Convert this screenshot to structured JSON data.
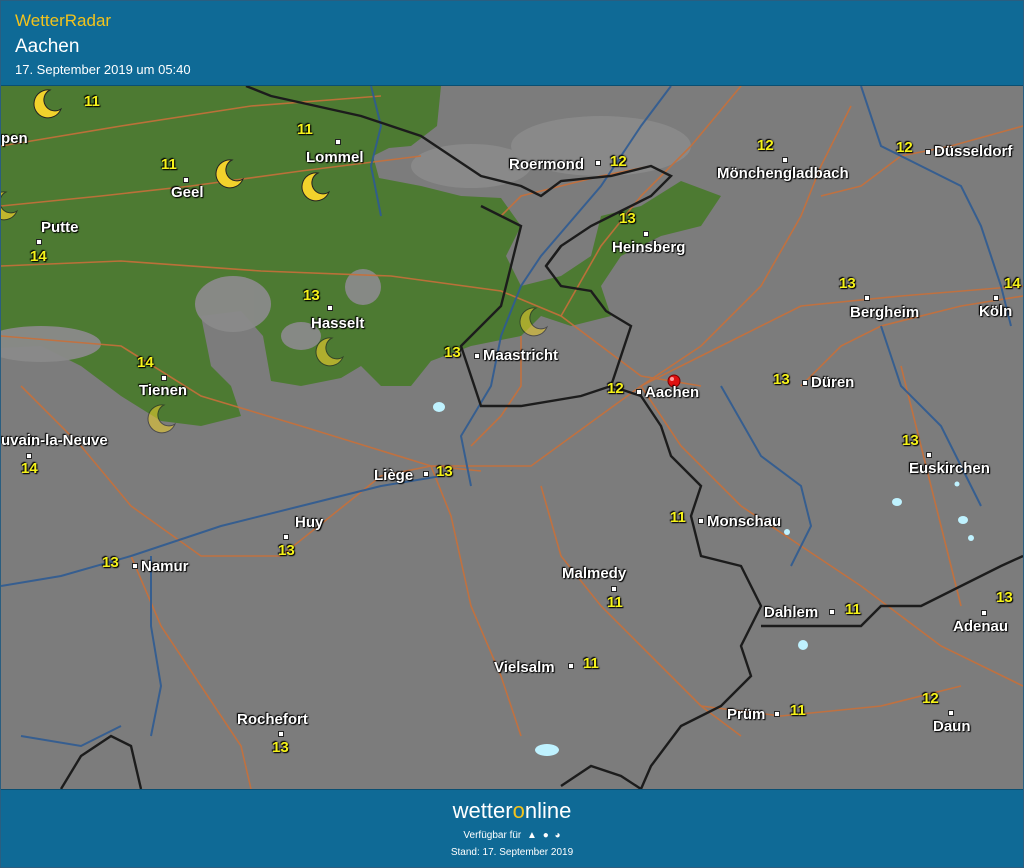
{
  "header": {
    "app_title": "WetterRadar",
    "location": "Aachen",
    "timestamp": "17. September 2019 um 05:40"
  },
  "map": {
    "colors": {
      "background": "#7c7c7c",
      "vegetation": "#4d7a32",
      "roads": "#c8703a",
      "rivers": "#2f5b92",
      "borders": "#1c1c1c",
      "temperature": "#f5f21a",
      "moon": "#f2d22c",
      "marker": "#e01010"
    },
    "places": [
      {
        "name": "Roermond",
        "temp": "12"
      },
      {
        "name": "Mönchengladbach",
        "temp": "12"
      },
      {
        "name": "Düsseldorf",
        "temp": "12"
      },
      {
        "name": "Lommel",
        "temp": "11"
      },
      {
        "name": "Geel",
        "temp": "11"
      },
      {
        "name": "Putte",
        "temp": "14"
      },
      {
        "name": "Heinsberg",
        "temp": "13"
      },
      {
        "name": "Hasselt",
        "temp": "13"
      },
      {
        "name": "Maastricht",
        "temp": "13"
      },
      {
        "name": "Bergheim",
        "temp": "13"
      },
      {
        "name": "Köln",
        "temp": "14"
      },
      {
        "name": "Tienen",
        "temp": "14"
      },
      {
        "name": "Aachen",
        "temp": "12"
      },
      {
        "name": "Düren",
        "temp": "13"
      },
      {
        "name": "uvain-la-Neuve",
        "temp": "14"
      },
      {
        "name": "Liège",
        "temp": "13"
      },
      {
        "name": "Euskirchen",
        "temp": "13"
      },
      {
        "name": "Huy",
        "temp": "13"
      },
      {
        "name": "Monschau",
        "temp": "11"
      },
      {
        "name": "Namur",
        "temp": "13"
      },
      {
        "name": "Malmedy",
        "temp": "11"
      },
      {
        "name": "Dahlem",
        "temp": "11"
      },
      {
        "name": "Adenau",
        "temp": "13"
      },
      {
        "name": "Vielsalm",
        "temp": "11"
      },
      {
        "name": "Prüm",
        "temp": "11"
      },
      {
        "name": "Rochefort",
        "temp": "13"
      },
      {
        "name": "Daun",
        "temp": "12"
      },
      {
        "name": "pen",
        "temp": ""
      }
    ],
    "extra_temps": [
      "11",
      "11"
    ]
  },
  "footer": {
    "brand_part1": "wetter",
    "brand_o": "o",
    "brand_part2": "nline",
    "available": "Verfügbar für",
    "stand": "Stand: 17. September 2019"
  }
}
